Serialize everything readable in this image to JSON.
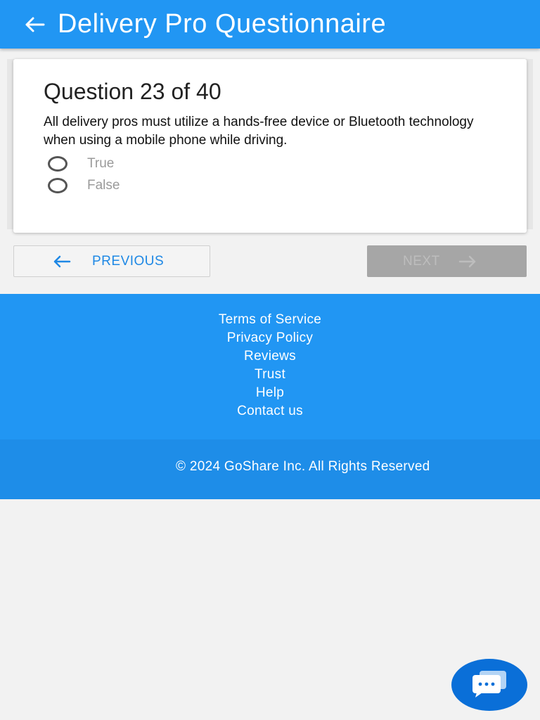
{
  "header": {
    "title": "Delivery Pro Questionnaire",
    "back_icon": "arrow-left-icon"
  },
  "question": {
    "heading": "Question 23 of 40",
    "text": "All delivery pros must utilize a hands-free device or Bluetooth technology when using a mobile phone while driving.",
    "options": [
      {
        "label": "True"
      },
      {
        "label": "False"
      }
    ]
  },
  "navigation": {
    "previous_label": "PREVIOUS",
    "next_label": "NEXT"
  },
  "footer": {
    "links": [
      "Terms of Service",
      "Privacy Policy",
      "Reviews",
      "Trust",
      "Help",
      "Contact us"
    ],
    "copyright": "© 2024 GoShare Inc. All Rights Reserved"
  },
  "colors": {
    "primary": "#2196f3",
    "footer_bottom": "#1e8de8",
    "chat_button": "#0a6fd8",
    "next_disabled": "#a6a6a6"
  }
}
